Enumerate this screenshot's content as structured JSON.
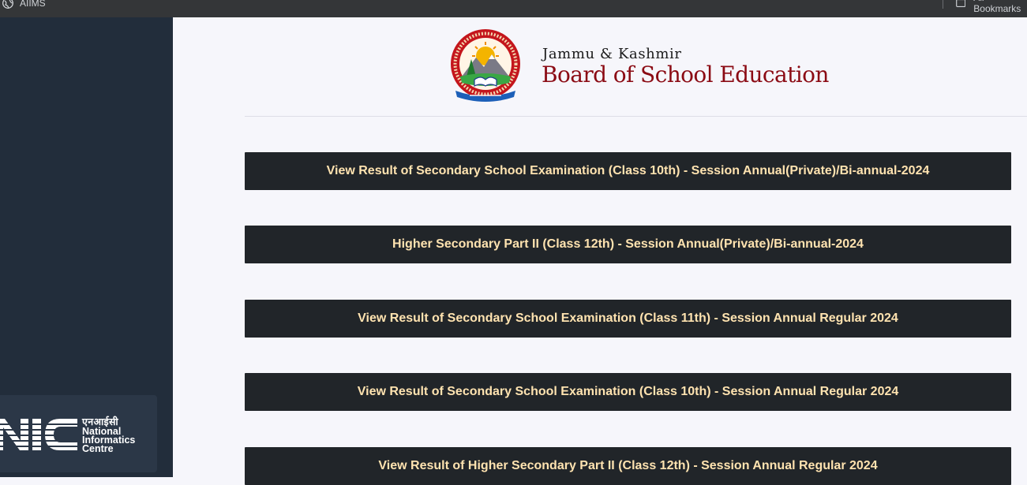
{
  "browser": {
    "bookmarks_left": "AIIMS",
    "bookmarks_right": "All Bookmarks"
  },
  "sidebar": {
    "nic": {
      "hindi": "एनआईसी",
      "line1": "National",
      "line2": "Informatics",
      "line3": "Centre"
    }
  },
  "header": {
    "line1": "Jammu & Kashmir",
    "line2": "Board of School Education"
  },
  "results": [
    {
      "label": "View Result of Secondary School Examination (Class 10th) - Session Annual(Private)/Bi-annual-2024"
    },
    {
      "label": "Higher Secondary Part II (Class 12th) - Session Annual(Private)/Bi-annual-2024"
    },
    {
      "label": "View Result of Secondary School Examination (Class 11th) - Session Annual Regular 2024"
    },
    {
      "label": "View Result of Secondary School Examination (Class 10th) - Session Annual Regular 2024"
    },
    {
      "label": "View Result of Higher Secondary Part II (Class 12th) - Session Annual Regular 2024"
    }
  ],
  "colors": {
    "sidebar_bg": "#222d3b",
    "button_bg": "#212529",
    "button_text": "#ffe3b0",
    "brand_red": "#8b0b14"
  }
}
